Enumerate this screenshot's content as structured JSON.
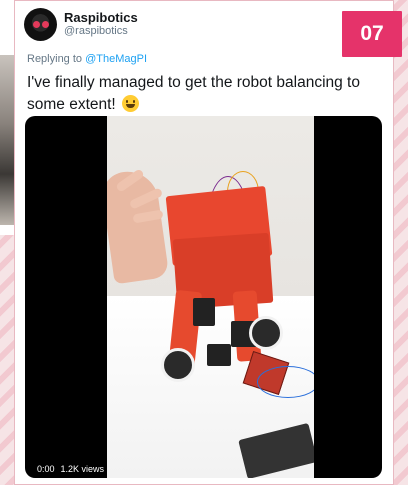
{
  "tweet": {
    "display_name": "Raspibotics",
    "handle": "@raspibotics",
    "reply_prefix": "Replying to",
    "reply_mention": "@TheMagPI",
    "text": "I've finally managed to get the robot balancing to some extent!",
    "emoji": "grinning-face"
  },
  "badge": {
    "number": "07",
    "color": "#e5336a"
  },
  "video": {
    "time": "0:00",
    "views": "1.2K views"
  },
  "colors": {
    "mention": "#1da1f2",
    "badge": "#e5336a"
  }
}
